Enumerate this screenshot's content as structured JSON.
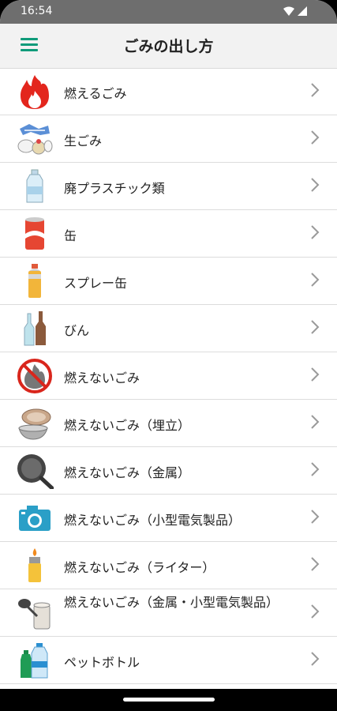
{
  "status": {
    "time": "16:54"
  },
  "appbar": {
    "title": "ごみの出し方"
  },
  "items": [
    {
      "label": "燃えるごみ",
      "icon": "fire-icon"
    },
    {
      "label": "生ごみ",
      "icon": "food-waste-icon"
    },
    {
      "label": "廃プラスチック類",
      "icon": "plastic-bottle-icon"
    },
    {
      "label": "缶",
      "icon": "can-icon"
    },
    {
      "label": "スプレー缶",
      "icon": "spray-can-icon"
    },
    {
      "label": "びん",
      "icon": "glass-bottle-icon"
    },
    {
      "label": "燃えないごみ",
      "icon": "no-fire-icon"
    },
    {
      "label": "燃えないごみ（埋立）",
      "icon": "pottery-icon"
    },
    {
      "label": "燃えないごみ（金属）",
      "icon": "frying-pan-icon"
    },
    {
      "label": "燃えないごみ（小型電気製品）",
      "icon": "camera-icon"
    },
    {
      "label": "燃えないごみ（ライター）",
      "icon": "lighter-icon"
    },
    {
      "label": "燃えないごみ（金属・小型電気製品）",
      "icon": "small-metal-appliance-icon"
    },
    {
      "label": "ペットボトル",
      "icon": "pet-bottle-icon"
    }
  ]
}
